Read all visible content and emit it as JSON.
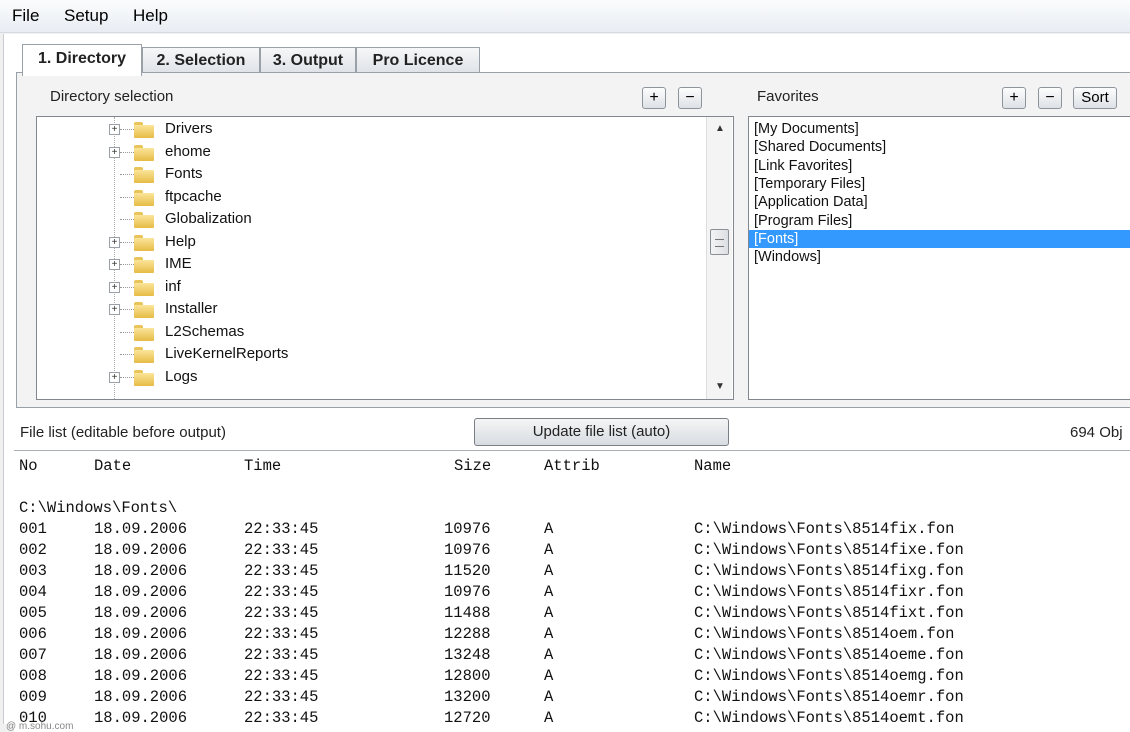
{
  "menu": {
    "file": "File",
    "setup": "Setup",
    "help": "Help"
  },
  "tabs": [
    "1. Directory",
    "2. Selection",
    "3. Output",
    "Pro Licence"
  ],
  "directory": {
    "label": "Directory selection",
    "add_label": "+",
    "remove_label": "−",
    "tree": [
      {
        "name": "Drivers",
        "expandable": true
      },
      {
        "name": "ehome",
        "expandable": true
      },
      {
        "name": "Fonts",
        "expandable": false
      },
      {
        "name": "ftpcache",
        "expandable": false
      },
      {
        "name": "Globalization",
        "expandable": false
      },
      {
        "name": "Help",
        "expandable": true
      },
      {
        "name": "IME",
        "expandable": true
      },
      {
        "name": "inf",
        "expandable": true
      },
      {
        "name": "Installer",
        "expandable": true
      },
      {
        "name": "L2Schemas",
        "expandable": false
      },
      {
        "name": "LiveKernelReports",
        "expandable": false
      },
      {
        "name": "Logs",
        "expandable": true
      }
    ]
  },
  "favorites": {
    "label": "Favorites",
    "add_label": "+",
    "remove_label": "−",
    "sort_label": "Sort",
    "items": [
      "[My Documents]",
      "[Shared Documents]",
      "[Link Favorites]",
      "[Temporary Files]",
      "[Application Data]",
      "[Program Files]",
      "[Fonts]",
      "[Windows]"
    ],
    "selected": "[Fonts]"
  },
  "filebar": {
    "label": "File list (editable before output)",
    "update_label": "Update file list (auto)",
    "count": "694 Obj"
  },
  "filelist": {
    "headers": [
      "No",
      "Date",
      "Time",
      "Size",
      "Attrib",
      "Name"
    ],
    "folder": "C:\\Windows\\Fonts\\",
    "rows": [
      [
        "001",
        "18.09.2006",
        "22:33:45",
        "10976",
        "A",
        "C:\\Windows\\Fonts\\8514fix.fon"
      ],
      [
        "002",
        "18.09.2006",
        "22:33:45",
        "10976",
        "A",
        "C:\\Windows\\Fonts\\8514fixe.fon"
      ],
      [
        "003",
        "18.09.2006",
        "22:33:45",
        "11520",
        "A",
        "C:\\Windows\\Fonts\\8514fixg.fon"
      ],
      [
        "004",
        "18.09.2006",
        "22:33:45",
        "10976",
        "A",
        "C:\\Windows\\Fonts\\8514fixr.fon"
      ],
      [
        "005",
        "18.09.2006",
        "22:33:45",
        "11488",
        "A",
        "C:\\Windows\\Fonts\\8514fixt.fon"
      ],
      [
        "006",
        "18.09.2006",
        "22:33:45",
        "12288",
        "A",
        "C:\\Windows\\Fonts\\8514oem.fon"
      ],
      [
        "007",
        "18.09.2006",
        "22:33:45",
        "13248",
        "A",
        "C:\\Windows\\Fonts\\8514oeme.fon"
      ],
      [
        "008",
        "18.09.2006",
        "22:33:45",
        "12800",
        "A",
        "C:\\Windows\\Fonts\\8514oemg.fon"
      ],
      [
        "009",
        "18.09.2006",
        "22:33:45",
        "13200",
        "A",
        "C:\\Windows\\Fonts\\8514oemr.fon"
      ],
      [
        "010",
        "18.09.2006",
        "22:33:45",
        "12720",
        "A",
        "C:\\Windows\\Fonts\\8514oemt.fon"
      ]
    ]
  },
  "watermark": "@ m.sohu.com"
}
